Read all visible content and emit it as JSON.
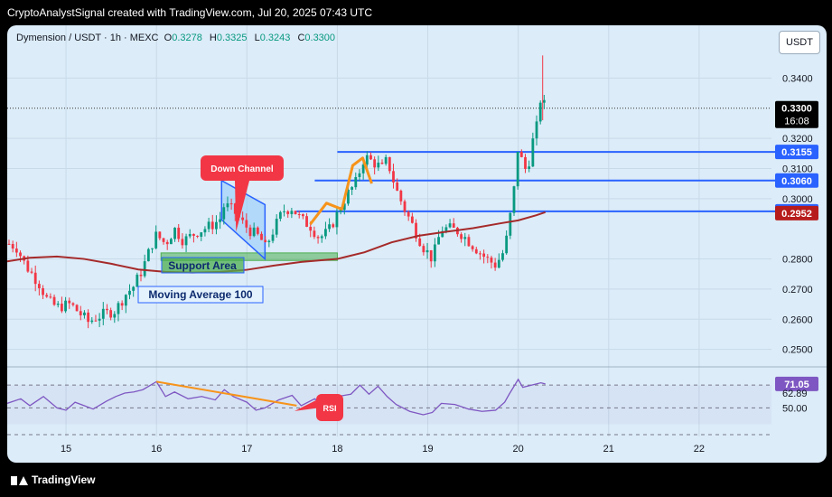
{
  "header": {
    "caption": "CryptoAnalystSignal created with TradingView.com, Jul 20, 2025 07:43 UTC"
  },
  "footer": {
    "brand": "TradingView"
  },
  "legend": {
    "symbol": "Dymension / USDT · 1h · MEXC",
    "open_key": "O",
    "open": "0.3278",
    "high_key": "H",
    "high": "0.3325",
    "low_key": "L",
    "low": "0.3243",
    "close_key": "C",
    "close": "0.3300"
  },
  "unit": "USDT",
  "colors": {
    "up": "#089981",
    "down": "#f23645",
    "ma": "#a52a2a",
    "level": "#2962ff",
    "rsi": "#7e57c2",
    "orange": "#f7931a",
    "support": "#4caf50",
    "channel": "#2962ff"
  },
  "chart_data": {
    "type": "candlestick",
    "price_ticks": [
      "0.3400",
      "0.3200",
      "0.3100",
      "0.3000",
      "0.2800",
      "0.2700",
      "0.2600",
      "0.2500"
    ],
    "price_tick_values": [
      0.34,
      0.32,
      0.31,
      0.3,
      0.28,
      0.27,
      0.26,
      0.25
    ],
    "ylim": [
      0.246,
      0.3485
    ],
    "x_ticks": [
      {
        "label": "15",
        "day": 15
      },
      {
        "label": "16",
        "day": 16
      },
      {
        "label": "17",
        "day": 17
      },
      {
        "label": "18",
        "day": 18
      },
      {
        "label": "19",
        "day": 19
      },
      {
        "label": "20",
        "day": 20
      },
      {
        "label": "21",
        "day": 21
      },
      {
        "label": "22",
        "day": 22
      }
    ],
    "xlim_days": [
      14.35,
      22.8
    ],
    "price_badges": [
      {
        "label": "0.3300",
        "sub": "16:08",
        "value": 0.33,
        "style": "last"
      },
      {
        "label": "0.3155",
        "value": 0.3155,
        "style": "level"
      },
      {
        "label": "0.3060",
        "value": 0.306,
        "style": "level"
      },
      {
        "label": "0.2958",
        "value": 0.2958,
        "style": "level"
      },
      {
        "label": "0.2952",
        "value": 0.2952,
        "style": "ma"
      }
    ],
    "levels": [
      {
        "value": 0.3155,
        "from_day": 18.0,
        "to_day": 22.8
      },
      {
        "value": 0.306,
        "from_day": 17.75,
        "to_day": 22.8
      },
      {
        "value": 0.2958,
        "from_day": 17.55,
        "to_day": 22.8
      }
    ],
    "annotations": {
      "down_channel_label": "Down Channel",
      "support_label": "Support Area",
      "ma_label": "Moving Average 100",
      "rsi_label": "RSI",
      "support_zone": {
        "from_day": 16.05,
        "to_day": 18.0,
        "low": 0.2795,
        "high": 0.282
      }
    },
    "moving_average_100": [
      [
        14.35,
        0.2792
      ],
      [
        14.6,
        0.2804
      ],
      [
        14.9,
        0.2808
      ],
      [
        15.2,
        0.28
      ],
      [
        15.5,
        0.2784
      ],
      [
        15.8,
        0.2765
      ],
      [
        16.1,
        0.2757
      ],
      [
        16.4,
        0.2755
      ],
      [
        16.7,
        0.2757
      ],
      [
        17.0,
        0.2764
      ],
      [
        17.3,
        0.2778
      ],
      [
        17.6,
        0.279
      ],
      [
        18.0,
        0.28
      ],
      [
        18.3,
        0.2822
      ],
      [
        18.6,
        0.2855
      ],
      [
        18.9,
        0.2877
      ],
      [
        19.2,
        0.289
      ],
      [
        19.5,
        0.2902
      ],
      [
        19.8,
        0.2918
      ],
      [
        20.0,
        0.2928
      ],
      [
        20.2,
        0.2945
      ],
      [
        20.3,
        0.2955
      ]
    ],
    "price_path": [
      [
        14.37,
        0.285
      ],
      [
        14.45,
        0.284
      ],
      [
        14.55,
        0.278
      ],
      [
        14.7,
        0.272
      ],
      [
        14.8,
        0.266
      ],
      [
        14.9,
        0.264
      ],
      [
        15.05,
        0.265
      ],
      [
        15.15,
        0.262
      ],
      [
        15.25,
        0.259
      ],
      [
        15.32,
        0.2605
      ],
      [
        15.45,
        0.262
      ],
      [
        15.55,
        0.263
      ],
      [
        15.65,
        0.268
      ],
      [
        15.75,
        0.271
      ],
      [
        15.85,
        0.277
      ],
      [
        15.95,
        0.285
      ],
      [
        16.0,
        0.288
      ],
      [
        16.1,
        0.285
      ],
      [
        16.2,
        0.29
      ],
      [
        16.3,
        0.286
      ],
      [
        16.45,
        0.289
      ],
      [
        16.6,
        0.291
      ],
      [
        16.7,
        0.293
      ],
      [
        16.75,
        0.298
      ],
      [
        16.85,
        0.296
      ],
      [
        16.95,
        0.292
      ],
      [
        17.05,
        0.289
      ],
      [
        17.15,
        0.287
      ],
      [
        17.2,
        0.2835
      ],
      [
        17.3,
        0.29
      ],
      [
        17.4,
        0.296
      ],
      [
        17.5,
        0.297
      ],
      [
        17.6,
        0.293
      ],
      [
        17.7,
        0.291
      ],
      [
        17.8,
        0.287
      ],
      [
        17.9,
        0.289
      ],
      [
        18.0,
        0.295
      ],
      [
        18.1,
        0.301
      ],
      [
        18.2,
        0.305
      ],
      [
        18.3,
        0.314
      ],
      [
        18.4,
        0.312
      ],
      [
        18.5,
        0.31
      ],
      [
        18.55,
        0.313
      ],
      [
        18.65,
        0.303
      ],
      [
        18.75,
        0.296
      ],
      [
        18.85,
        0.29
      ],
      [
        18.95,
        0.284
      ],
      [
        19.05,
        0.28
      ],
      [
        19.15,
        0.29
      ],
      [
        19.25,
        0.29
      ],
      [
        19.35,
        0.289
      ],
      [
        19.45,
        0.286
      ],
      [
        19.55,
        0.283
      ],
      [
        19.65,
        0.28
      ],
      [
        19.75,
        0.278
      ],
      [
        19.85,
        0.283
      ],
      [
        19.9,
        0.292
      ],
      [
        19.95,
        0.302
      ],
      [
        20.0,
        0.318
      ],
      [
        20.05,
        0.311
      ],
      [
        20.1,
        0.309
      ],
      [
        20.15,
        0.318
      ],
      [
        20.2,
        0.323
      ],
      [
        20.25,
        0.334
      ],
      [
        20.3,
        0.33
      ]
    ],
    "rsi": {
      "ticks": [
        {
          "label": "70.00",
          "value": 70
        },
        {
          "label": "50.00",
          "value": 50
        }
      ],
      "ylim": [
        25,
        82
      ],
      "badges": [
        {
          "label": "71.05",
          "value": 71.05,
          "style": "rsi"
        },
        {
          "label": "62.89",
          "value": 62.89,
          "style": "plain"
        }
      ],
      "path": [
        [
          14.35,
          54
        ],
        [
          14.5,
          58
        ],
        [
          14.6,
          52
        ],
        [
          14.75,
          60
        ],
        [
          14.9,
          50
        ],
        [
          15.0,
          48
        ],
        [
          15.1,
          55
        ],
        [
          15.2,
          52
        ],
        [
          15.3,
          49
        ],
        [
          15.45,
          56
        ],
        [
          15.55,
          60
        ],
        [
          15.65,
          63
        ],
        [
          15.75,
          64
        ],
        [
          15.85,
          66
        ],
        [
          16.0,
          73
        ],
        [
          16.1,
          60
        ],
        [
          16.2,
          64
        ],
        [
          16.35,
          58
        ],
        [
          16.5,
          60
        ],
        [
          16.65,
          57
        ],
        [
          16.75,
          66
        ],
        [
          16.85,
          60
        ],
        [
          17.0,
          55
        ],
        [
          17.1,
          48
        ],
        [
          17.2,
          50
        ],
        [
          17.35,
          57
        ],
        [
          17.5,
          61
        ],
        [
          17.6,
          52
        ],
        [
          17.75,
          58
        ],
        [
          17.85,
          52
        ],
        [
          18.0,
          60
        ],
        [
          18.15,
          62
        ],
        [
          18.25,
          70
        ],
        [
          18.35,
          62
        ],
        [
          18.45,
          69
        ],
        [
          18.55,
          60
        ],
        [
          18.65,
          53
        ],
        [
          18.8,
          47
        ],
        [
          18.95,
          44
        ],
        [
          19.05,
          46
        ],
        [
          19.15,
          54
        ],
        [
          19.3,
          53
        ],
        [
          19.45,
          49
        ],
        [
          19.6,
          47
        ],
        [
          19.75,
          48
        ],
        [
          19.85,
          55
        ],
        [
          19.9,
          62
        ],
        [
          20.0,
          75
        ],
        [
          20.05,
          68
        ],
        [
          20.15,
          70
        ],
        [
          20.25,
          72
        ],
        [
          20.3,
          71
        ]
      ],
      "trendline": [
        [
          16.0,
          73
        ],
        [
          17.55,
          52
        ]
      ]
    }
  }
}
